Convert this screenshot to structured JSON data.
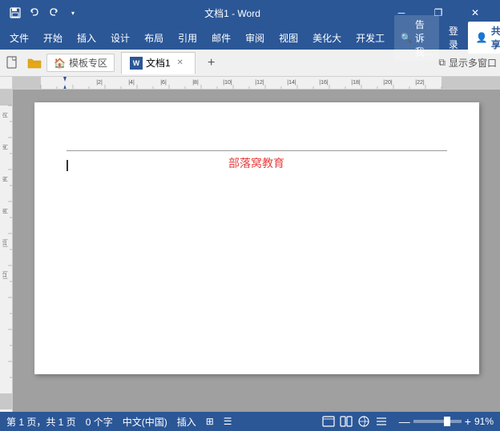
{
  "titleBar": {
    "title": "文档1 - Word",
    "qat": {
      "save": "💾",
      "undo": "↩",
      "redo": "↪",
      "dropdown": "▾"
    },
    "windowControls": {
      "minimize": "─",
      "restore": "❐",
      "close": "✕"
    }
  },
  "menuBar": {
    "items": [
      "文件",
      "开始",
      "插入",
      "设计",
      "布局",
      "引用",
      "邮件",
      "审阅",
      "视图",
      "美化大",
      "开发工"
    ],
    "tell": "告诉我...",
    "tellIcon": "🔍",
    "login": "登录",
    "share": "共享",
    "shareIcon": "👤"
  },
  "tabBar": {
    "moban": "模板专区",
    "tab1": "文档1",
    "addTab": "+",
    "displayWindow": "显示多窗口"
  },
  "ruler": {
    "unit": "cm"
  },
  "document": {
    "content": "部落窝教育",
    "headerLine": true
  },
  "statusBar": {
    "page": "第 1 页，共 1 页",
    "chars": "0 个字",
    "lang": "中文(中国)",
    "mode": "插入",
    "zoom": "91%",
    "viewBtns": [
      "📄",
      "☰",
      "🔲",
      "📊"
    ]
  }
}
